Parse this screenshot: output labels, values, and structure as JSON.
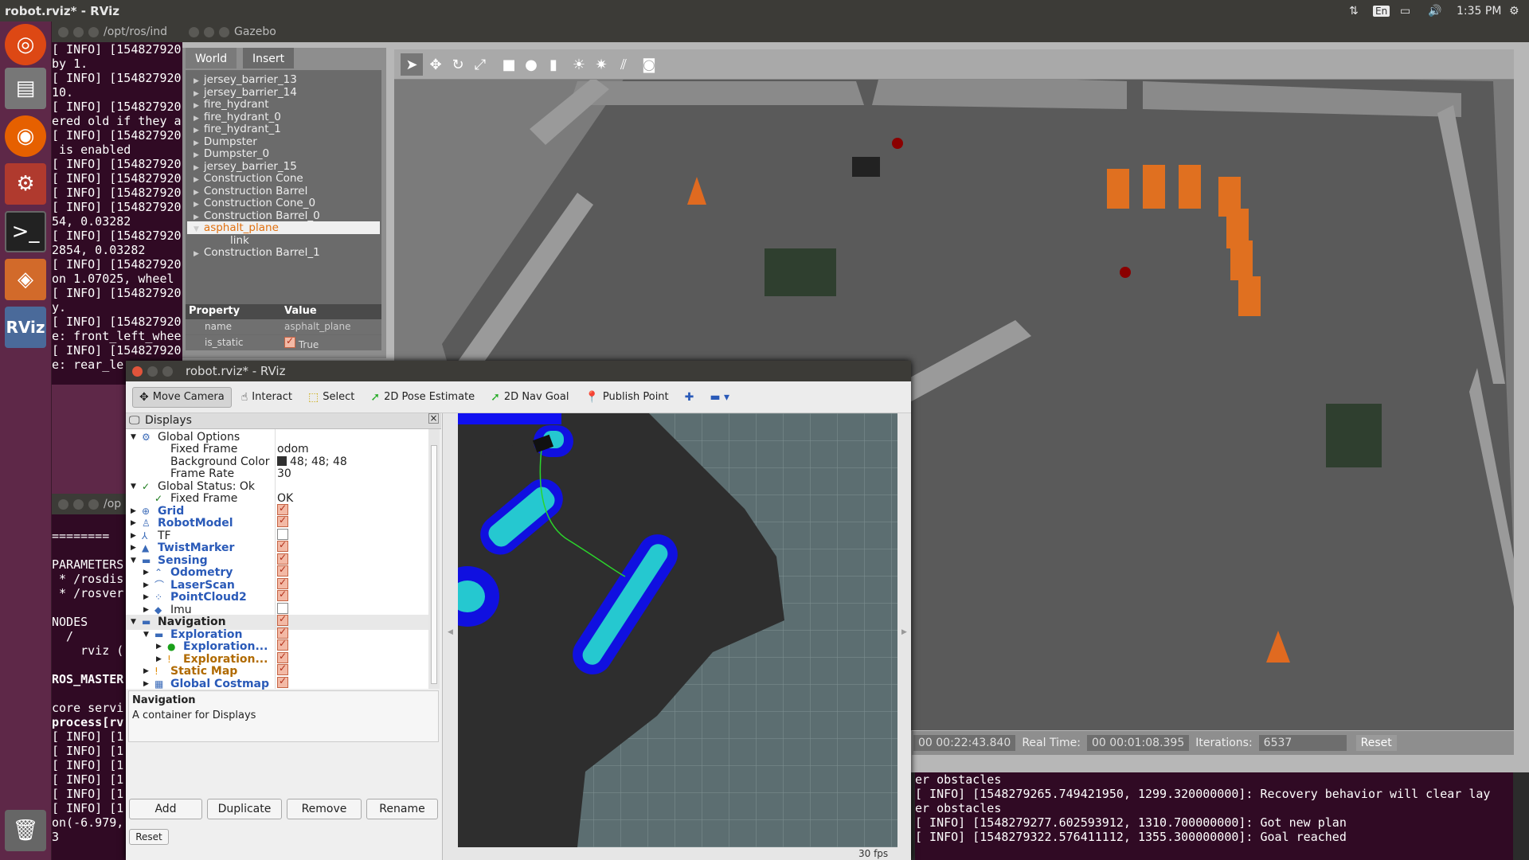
{
  "topbar": {
    "title": "robot.rviz* - RViz",
    "keyboard": "En",
    "time": "1:35 PM"
  },
  "launcher": {
    "icons": [
      "ubuntu-icon",
      "files-icon",
      "firefox-icon",
      "settings-icon",
      "terminal-icon",
      "package-icon",
      "rviz-icon",
      "trash-icon"
    ],
    "rviz_label": "RViz"
  },
  "term1": {
    "title": "/opt/ros/ind",
    "lines": [
      "[ INFO] [154827920",
      "by 1.",
      "[ INFO] [154827920",
      "10.",
      "[ INFO] [154827920",
      "ered old if they a",
      "[ INFO] [154827920",
      " is enabled",
      "[ INFO] [154827920",
      "[ INFO] [154827920",
      "[ INFO] [154827920",
      "[ INFO] [154827920",
      "54, 0.03282",
      "[ INFO] [154827920",
      "2854, 0.03282",
      "[ INFO] [154827920",
      "on 1.07025, wheel",
      "[ INFO] [154827920",
      "y.",
      "[ INFO] [154827920",
      "e: front_left_whee",
      "[ INFO] [154827920",
      "e: rear_le"
    ]
  },
  "term2": {
    "title": "/op",
    "lines": [
      "",
      "========",
      "",
      "PARAMETERS",
      " * /rosdis",
      " * /rosver",
      "",
      "NODES",
      "  /",
      "    rviz (",
      "",
      "ROS_MASTER",
      "",
      "core servi",
      "process[rv",
      "[ INFO] [1",
      "[ INFO] [1",
      "[ INFO] [1",
      "[ INFO] [1",
      "[ INFO] [1",
      "[ INFO] [1",
      "on(-6.979,",
      "3"
    ]
  },
  "gazebo": {
    "title": "Gazebo",
    "tabs": [
      "World",
      "Insert"
    ],
    "tree": [
      "jersey_barrier_13",
      "jersey_barrier_14",
      "fire_hydrant",
      "fire_hydrant_0",
      "fire_hydrant_1",
      "Dumpster",
      "Dumpster_0",
      "jersey_barrier_15",
      "Construction Cone",
      "Construction Barrel",
      "Construction Cone_0",
      "Construction Barrel_0",
      "asphalt_plane",
      "link",
      "Construction Barrel_1"
    ],
    "property_header": "Property",
    "value_header": "Value",
    "props": [
      {
        "k": "name",
        "v": "asphalt_plane"
      },
      {
        "k": "is_static",
        "v": "True"
      }
    ],
    "status": {
      "sim_time": "00 00:22:43.840",
      "real_label": "Real Time:",
      "real": "00 00:01:08.395",
      "iter_label": "Iterations:",
      "iter": "6537",
      "reset": "Reset"
    }
  },
  "rviz": {
    "title": "robot.rviz* - RViz",
    "tools": [
      {
        "label": "Move Camera",
        "icon": "move-camera-icon"
      },
      {
        "label": "Interact",
        "icon": "hand-icon"
      },
      {
        "label": "Select",
        "icon": "select-icon"
      },
      {
        "label": "2D Pose Estimate",
        "icon": "pose-arrow-icon"
      },
      {
        "label": "2D Nav Goal",
        "icon": "goal-arrow-icon"
      },
      {
        "label": "Publish Point",
        "icon": "pin-icon"
      }
    ],
    "panel_title": "Displays",
    "rows": [
      {
        "label": "Global Options",
        "value": "",
        "indent": 0,
        "arrow": "▼",
        "icon": "⚙",
        "cls": ""
      },
      {
        "label": "Fixed Frame",
        "value": "odom",
        "indent": 1,
        "arrow": "",
        "icon": "",
        "cls": ""
      },
      {
        "label": "Background Color",
        "value": "48; 48; 48",
        "indent": 1,
        "arrow": "",
        "icon": "",
        "cls": "",
        "swatch": true
      },
      {
        "label": "Frame Rate",
        "value": "30",
        "indent": 1,
        "arrow": "",
        "icon": "",
        "cls": ""
      },
      {
        "label": "Global Status: Ok",
        "value": "",
        "indent": 0,
        "arrow": "▼",
        "icon": "✓",
        "cls": ""
      },
      {
        "label": "Fixed Frame",
        "value": "OK",
        "indent": 1,
        "arrow": "",
        "icon": "✓",
        "cls": ""
      },
      {
        "label": "Grid",
        "cb": true,
        "indent": 0,
        "arrow": "▶",
        "icon": "⊕",
        "cls": "blue"
      },
      {
        "label": "RobotModel",
        "cb": true,
        "indent": 0,
        "arrow": "▶",
        "icon": "♙",
        "cls": "blue"
      },
      {
        "label": "TF",
        "cb": false,
        "indent": 0,
        "arrow": "▶",
        "icon": "⅄",
        "cls": ""
      },
      {
        "label": "TwistMarker",
        "cb": true,
        "indent": 0,
        "arrow": "▶",
        "icon": "▲",
        "cls": "blue"
      },
      {
        "label": "Sensing",
        "cb": true,
        "indent": 0,
        "arrow": "▼",
        "icon": "▬",
        "cls": "blue"
      },
      {
        "label": "Odometry",
        "cb": true,
        "indent": 1,
        "arrow": "▶",
        "icon": "⌃",
        "cls": "blue"
      },
      {
        "label": "LaserScan",
        "cb": true,
        "indent": 1,
        "arrow": "▶",
        "icon": "⌒",
        "cls": "blue"
      },
      {
        "label": "PointCloud2",
        "cb": true,
        "indent": 1,
        "arrow": "▶",
        "icon": "⁘",
        "cls": "blue"
      },
      {
        "label": "Imu",
        "cb": false,
        "indent": 1,
        "arrow": "▶",
        "icon": "◆",
        "cls": ""
      },
      {
        "label": "Navigation",
        "cb": true,
        "indent": 0,
        "arrow": "▼",
        "icon": "▬",
        "cls": "bold"
      },
      {
        "label": "Exploration",
        "cb": true,
        "indent": 1,
        "arrow": "▼",
        "icon": "▬",
        "cls": "blue"
      },
      {
        "label": "Exploration...",
        "cb": true,
        "indent": 2,
        "arrow": "▶",
        "icon": "●",
        "cls": "blue"
      },
      {
        "label": "Exploration...",
        "cb": true,
        "indent": 2,
        "arrow": "▶",
        "icon": "!",
        "cls": "orange"
      },
      {
        "label": "Static Map",
        "cb": true,
        "indent": 1,
        "arrow": "▶",
        "icon": "!",
        "cls": "orange"
      },
      {
        "label": "Global Costmap",
        "cb": true,
        "indent": 1,
        "arrow": "▶",
        "icon": "▦",
        "cls": "blue"
      }
    ],
    "desc_title": "Navigation",
    "desc_text": "A container for Displays",
    "buttons": [
      "Add",
      "Duplicate",
      "Remove",
      "Rename"
    ],
    "reset": "Reset",
    "fps": "30 fps"
  },
  "term3": {
    "lines": [
      "er obstacles",
      "[ INFO] [1548279265.749421950, 1299.320000000]: Recovery behavior will clear lay",
      "er obstacles",
      "[ INFO] [1548279277.602593912, 1310.700000000]: Got new plan",
      "[ INFO] [1548279322.576411112, 1355.300000000]: Goal reached"
    ]
  }
}
